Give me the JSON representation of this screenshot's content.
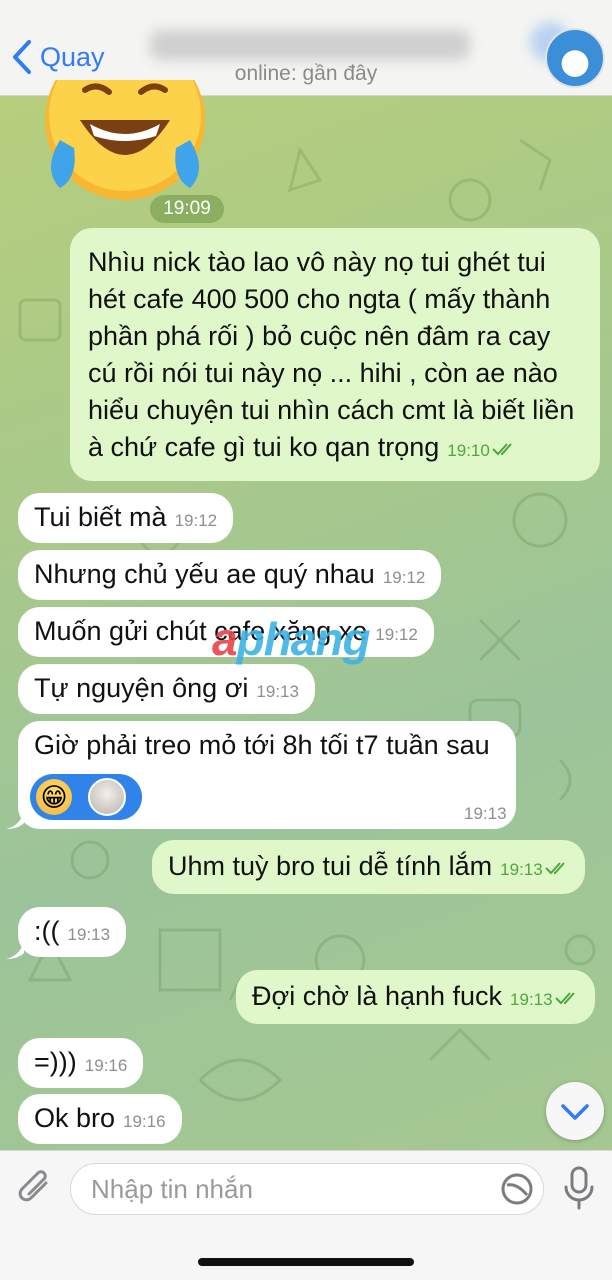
{
  "header": {
    "back_label": "Quay",
    "status": "online: gần đây"
  },
  "emoji_time": "19:09",
  "messages": [
    {
      "side": "out",
      "text": "Nhìu nick tào lao vô này nọ tui ghét tui hét cafe 400 500 cho ngta ( mấy thành phần phá rối ) bỏ cuộc nên đâm ra cay cú rồi nói tui này nọ ... hihi , còn ae nào hiểu chuyện tui nhìn cách cmt là biết liền à chứ cafe gì tui ko qan trọng",
      "time": "19:10"
    },
    {
      "side": "in",
      "text": "Tui biết mà",
      "time": "19:12"
    },
    {
      "side": "in",
      "text": "Nhưng chủ yếu ae quý nhau",
      "time": "19:12"
    },
    {
      "side": "in",
      "text": "Muốn gửi chút cafe xăng xe",
      "time": "19:12"
    },
    {
      "side": "in",
      "text": "Tự nguyện ông ơi",
      "time": "19:13"
    },
    {
      "side": "in",
      "text": "Giờ phải treo mỏ tới 8h tối t7 tuần sau",
      "time": "19:13"
    },
    {
      "side": "out",
      "text": "Uhm tuỳ bro tui dễ tính lắm",
      "time": "19:13"
    },
    {
      "side": "in",
      "text": ":((",
      "time": "19:13"
    },
    {
      "side": "out",
      "text": "Đợi chờ là hạnh fuck",
      "time": "19:13"
    },
    {
      "side": "in",
      "text": "=)))",
      "time": "19:16"
    },
    {
      "side": "in",
      "text": "Ok bro",
      "time": "19:16"
    }
  ],
  "reaction": {
    "emoji": "😁"
  },
  "watermark": {
    "part1": "a",
    "part2": "phang"
  },
  "input": {
    "placeholder": "Nhập tin nhắn"
  },
  "colors": {
    "accent": "#2f7cf6",
    "outgoing_bubble": "#e0f8c9",
    "incoming_bubble": "#ffffff",
    "read_check": "#4ca83d"
  },
  "icons": [
    "chevron-left-icon",
    "laughing-tears-emoji",
    "double-check-icon",
    "chevron-down-icon",
    "paperclip-icon",
    "sticker-icon",
    "microphone-icon"
  ]
}
